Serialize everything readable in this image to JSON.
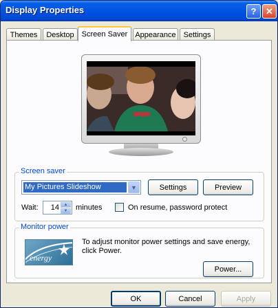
{
  "window": {
    "title": "Display Properties",
    "help_glyph": "?",
    "close_glyph": "✕"
  },
  "tabs": [
    "Themes",
    "Desktop",
    "Screen Saver",
    "Appearance",
    "Settings"
  ],
  "active_tab": "Screen Saver",
  "screen_saver": {
    "group_label": "Screen saver",
    "selected": "My Pictures Slideshow",
    "settings_label": "Settings",
    "preview_label": "Preview",
    "wait_label": "Wait:",
    "wait_value": "14",
    "minutes_label": "minutes",
    "resume_label": "On resume, password protect",
    "resume_checked": false
  },
  "monitor_power": {
    "group_label": "Monitor power",
    "description": "To adjust monitor power settings and save energy, click Power.",
    "power_label": "Power...",
    "logo_text": "energy"
  },
  "footer": {
    "ok": "OK",
    "cancel": "Cancel",
    "apply": "Apply"
  },
  "colors": {
    "titlebar": "#0054e3",
    "face": "#ece9d8",
    "group_label": "#0046d5",
    "selection": "#316ac5",
    "active_tab_accent": "#ffc83c"
  },
  "icons": [
    "help-icon",
    "close-icon",
    "dropdown-arrow-icon",
    "spin-up-icon",
    "spin-down-icon",
    "energy-star-logo"
  ]
}
